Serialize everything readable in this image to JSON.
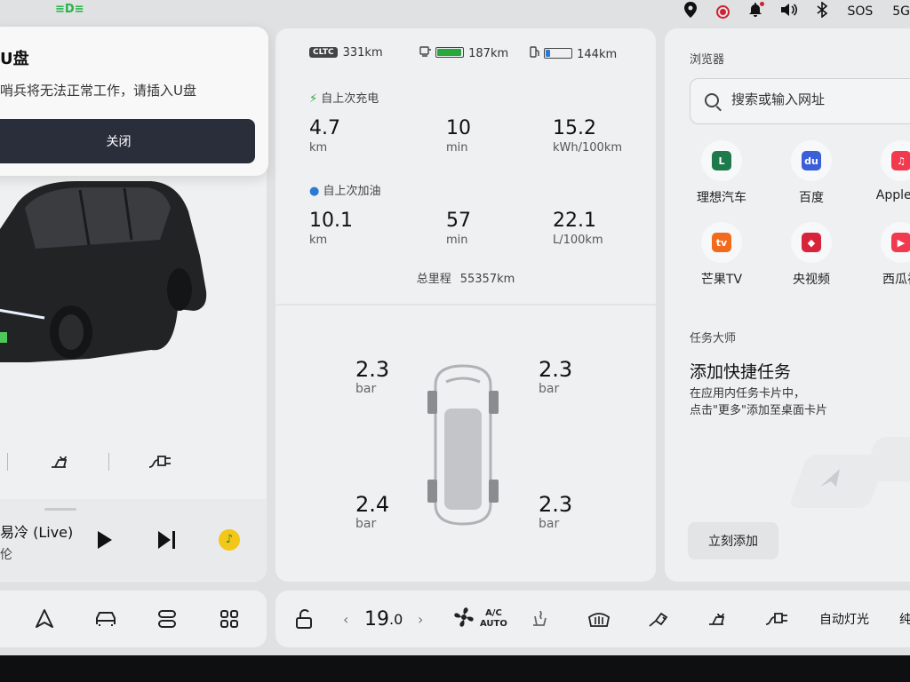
{
  "statusbar": {
    "headlight_icon": "headlight-icon",
    "sos_label": "SOS",
    "network_label": "5G"
  },
  "usb_popup": {
    "title": "U盘",
    "message": "哨兵将无法正常工作，请插入U盘",
    "close_label": "关闭"
  },
  "media": {
    "song": "易冷 (Live)",
    "artist": "伦"
  },
  "trip": {
    "cltc_badge": "CLTC",
    "cltc_range": "331km",
    "electric_range": "187km",
    "battery_level": 0.9,
    "battery_color": "#27a83a",
    "fuel_range": "144km",
    "fuel_level": 0.15,
    "fuel_color": "#2a7ad6",
    "since_charge": {
      "label": "自上次充电",
      "distance": "4.7",
      "distance_unit": "km",
      "time": "10",
      "time_unit": "min",
      "consumption": "15.2",
      "consumption_unit": "kWh/100km"
    },
    "since_refuel": {
      "label": "自上次加油",
      "distance": "10.1",
      "distance_unit": "km",
      "time": "57",
      "time_unit": "min",
      "consumption": "22.1",
      "consumption_unit": "L/100km"
    },
    "odometer_label": "总里程",
    "odometer_value": "55357km"
  },
  "tires": {
    "front_left": {
      "value": "2.3",
      "unit": "bar"
    },
    "front_right": {
      "value": "2.3",
      "unit": "bar"
    },
    "rear_left": {
      "value": "2.4",
      "unit": "bar"
    },
    "rear_right": {
      "value": "2.3",
      "unit": "bar"
    }
  },
  "browser": {
    "label": "浏览器",
    "search_placeholder": "搜索或输入网址",
    "apps": [
      {
        "name": "理想汽车",
        "icon": "li-auto-icon",
        "color": "#1e7a4a"
      },
      {
        "name": "百度",
        "icon": "baidu-icon",
        "color": "#3a5fd8"
      },
      {
        "name": "Apple M",
        "icon": "apple-music-icon",
        "color": "#f23a4e"
      },
      {
        "name": "芒果TV",
        "icon": "mango-tv-icon",
        "color": "#f26b1d"
      },
      {
        "name": "央视频",
        "icon": "cctv-video-icon",
        "color": "#d8243a"
      },
      {
        "name": "西瓜视",
        "icon": "xigua-video-icon",
        "color": "#f23a4e"
      }
    ]
  },
  "tasks": {
    "label": "任务大师",
    "title": "添加快捷任务",
    "desc_line1": "在应用内任务卡片中，",
    "desc_line2": "点击\"更多\"添加至桌面卡片",
    "add_label": "立刻添加"
  },
  "climate": {
    "temperature": "19",
    "temperature_decimal": ".0",
    "ac_label": "A/C",
    "auto_label": "AUTO",
    "auto_light_label": "自动灯光",
    "extra_label": "纯"
  }
}
